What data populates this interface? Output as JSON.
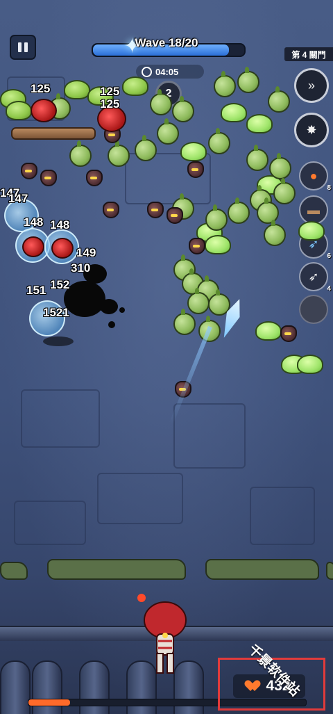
{
  "hud": {
    "wave_label": "Wave 18/20",
    "wave_progress": 0.9,
    "timer": "04:05",
    "pending_count": "2",
    "stage_tag": "第 4 關門",
    "pause_icon": "pause-icon"
  },
  "skills": [
    {
      "name": "fast-forward-icon",
      "count": ""
    },
    {
      "name": "burst-icon",
      "count": ""
    },
    {
      "name": "fireball-icon",
      "count": "8"
    },
    {
      "name": "spiked-log-icon",
      "count": ""
    },
    {
      "name": "ice-arrow-icon",
      "count": "6"
    },
    {
      "name": "arrow-icon",
      "count": "4"
    },
    {
      "name": "empty-slot-icon",
      "count": ""
    }
  ],
  "damage_numbers": [
    "125",
    "125",
    "125",
    "147",
    "147",
    "148",
    "148",
    "149",
    "310",
    "151",
    "152",
    "1521"
  ],
  "player": {
    "hp": "432",
    "hp_fraction": 0.15
  },
  "watermark": "千景软件站",
  "colors": {
    "wave_bar": "#2b6fd6",
    "hp_bar": "#ff6a2a",
    "highlight": "#e23b3b"
  }
}
